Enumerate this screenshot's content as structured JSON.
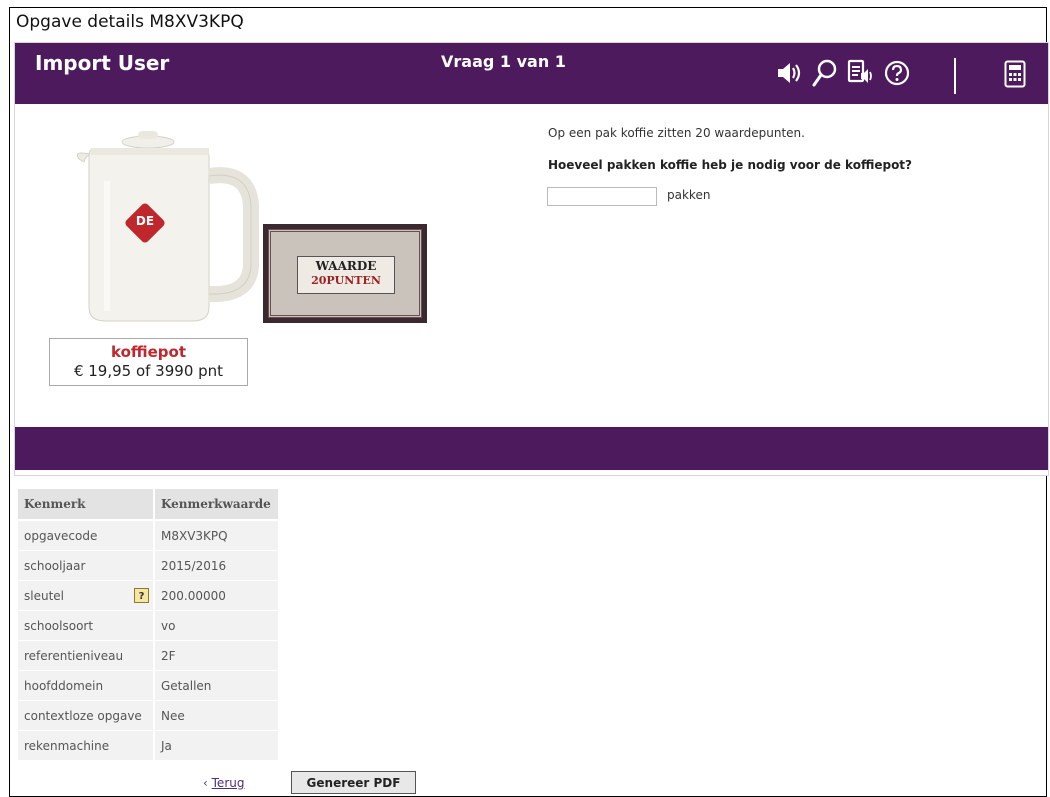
{
  "page": {
    "title": "Opgave details M8XV3KPQ"
  },
  "header": {
    "user": "Import User",
    "question_counter": "Vraag 1 van 1",
    "icons": [
      "speaker-icon",
      "search-icon",
      "read-aloud-icon",
      "help-icon",
      "calculator-icon"
    ]
  },
  "product": {
    "name": "koffiepot",
    "price": "€ 19,95 of 3990 pnt",
    "logo_text": "DE",
    "stamp_text_top": "WAARDE",
    "stamp_text_bottom": "20PUNTEN"
  },
  "question": {
    "intro": "Op een pak koffie zitten 20 waardepunten.",
    "prompt": "Hoeveel pakken koffie heb je nodig voor de koffiepot?",
    "answer_value": "",
    "unit": "pakken"
  },
  "table": {
    "headers": [
      "Kenmerk",
      "Kenmerkwaarde"
    ],
    "rows": [
      {
        "key": "opgavecode",
        "value": "M8XV3KPQ"
      },
      {
        "key": "schooljaar",
        "value": "2015/2016"
      },
      {
        "key": "sleutel",
        "value": "200.00000",
        "help": "?"
      },
      {
        "key": "schoolsoort",
        "value": "vo"
      },
      {
        "key": "referentieniveau",
        "value": "2F"
      },
      {
        "key": "hoofddomein",
        "value": "Getallen"
      },
      {
        "key": "contextloze opgave",
        "value": "Nee"
      },
      {
        "key": "rekenmachine",
        "value": "Ja"
      }
    ]
  },
  "footer": {
    "back_arrow": "‹",
    "back_label": "Terug",
    "pdf_label": "Genereer PDF"
  },
  "colors": {
    "brand": "#4e1a5e",
    "product_red": "#c0272d"
  }
}
